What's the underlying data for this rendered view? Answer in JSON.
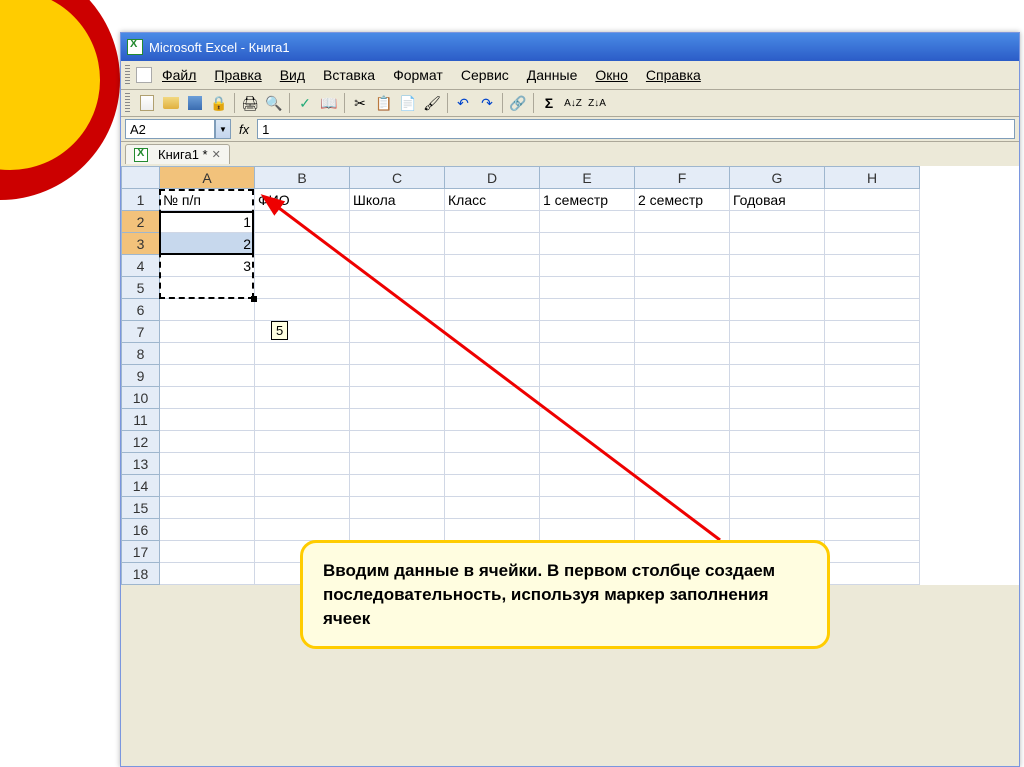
{
  "title": "Microsoft Excel - Книга1",
  "menu": {
    "file": "Файл",
    "edit": "Правка",
    "view": "Вид",
    "insert": "Вставка",
    "format": "Формат",
    "tools": "Сервис",
    "data": "Данные",
    "window": "Окно",
    "help": "Справка"
  },
  "nameBox": "A2",
  "fxLabel": "fx",
  "formulaValue": "1",
  "tabName": "Книга1 *",
  "colWidths": {
    "A": 95,
    "B": 95,
    "C": 95,
    "D": 95,
    "E": 95,
    "F": 95,
    "G": 95,
    "H": 95
  },
  "columns": [
    "A",
    "B",
    "C",
    "D",
    "E",
    "F",
    "G",
    "H"
  ],
  "rows": [
    "1",
    "2",
    "3",
    "4",
    "5",
    "6",
    "7",
    "8",
    "9",
    "10",
    "11",
    "12",
    "13",
    "14",
    "15",
    "16",
    "17",
    "18"
  ],
  "headers": {
    "A": "№ п/п",
    "B": "ФИО",
    "C": "Школа",
    "D": "Класс",
    "E": "1 семестр",
    "F": "2 семестр",
    "G": "Годовая"
  },
  "colAData": {
    "r2": "1",
    "r3": "2",
    "r4": "3"
  },
  "fillTooltip": "5",
  "callout": "Вводим данные в ячейки. В первом столбце создаем последовательность, используя маркер заполнения ячеек"
}
